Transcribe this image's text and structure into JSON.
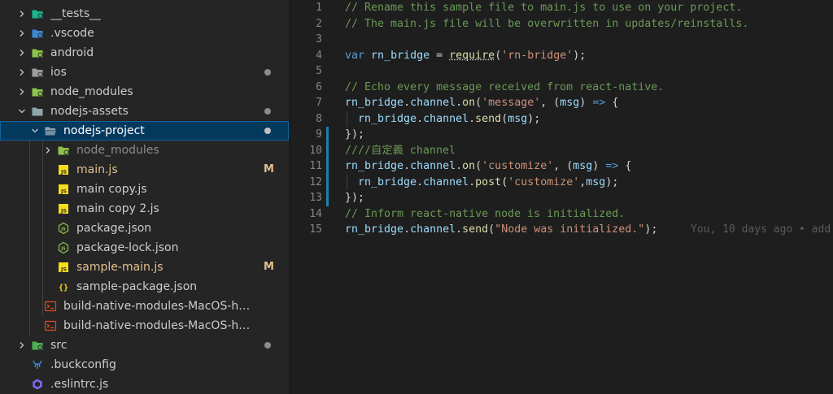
{
  "explorer": {
    "items": [
      {
        "label": "__tests__",
        "type": "folder",
        "icon": "test-folder-icon",
        "color": "#19b68f"
      },
      {
        "label": ".vscode",
        "type": "folder",
        "icon": "vscode-folder-icon",
        "color": "#3b88d6"
      },
      {
        "label": "android",
        "type": "folder",
        "icon": "android-folder-icon",
        "color": "#8bc34a"
      },
      {
        "label": "ios",
        "type": "folder",
        "icon": "ios-folder-icon",
        "color": "#9e9e9e",
        "status": "dot"
      },
      {
        "label": "node_modules",
        "type": "folder",
        "icon": "node-folder-icon",
        "color": "#8bc34a"
      },
      {
        "label": "nodejs-assets",
        "type": "folder",
        "icon": "folder-icon",
        "color": "#90a4ae",
        "status": "dot"
      },
      {
        "label": "nodejs-project",
        "type": "folder-open",
        "icon": "folder-open-icon",
        "color": "#90a4ae",
        "status": "dot",
        "selected": true
      },
      {
        "label": "node_modules",
        "type": "folder",
        "icon": "node-folder-icon",
        "color": "#8bc34a",
        "dimmed": true
      },
      {
        "label": "main.js",
        "type": "file",
        "icon": "js-file-icon",
        "color": "#f5de19",
        "badge": "M"
      },
      {
        "label": "main copy.js",
        "type": "file",
        "icon": "js-file-icon",
        "color": "#f5de19"
      },
      {
        "label": "main copy 2.js",
        "type": "file",
        "icon": "js-file-icon",
        "color": "#f5de19"
      },
      {
        "label": "package.json",
        "type": "file",
        "icon": "nodejs-file-icon",
        "color": "#8bc34a"
      },
      {
        "label": "package-lock.json",
        "type": "file",
        "icon": "nodejs-file-icon",
        "color": "#8bc34a"
      },
      {
        "label": "sample-main.js",
        "type": "file",
        "icon": "js-file-icon",
        "color": "#f5de19",
        "badge": "M"
      },
      {
        "label": "sample-package.json",
        "type": "file",
        "icon": "json-file-icon",
        "color": "#f5de19"
      },
      {
        "label": "build-native-modules-MacOS-helper-scrip...",
        "type": "file",
        "icon": "shell-file-icon",
        "color": "#e64a19"
      },
      {
        "label": "build-native-modules-MacOS-helper-scrip...",
        "type": "file",
        "icon": "shell-file-icon",
        "color": "#e64a19"
      },
      {
        "label": "src",
        "type": "folder",
        "icon": "src-folder-icon",
        "color": "#4caf50",
        "status": "dot"
      },
      {
        "label": ".buckconfig",
        "type": "file",
        "icon": "buck-file-icon",
        "color": "#3b88d6"
      },
      {
        "label": ".eslintrc.js",
        "type": "file",
        "icon": "eslint-file-icon",
        "color": "#7b68ee"
      }
    ]
  },
  "editor": {
    "lines": [
      {
        "num": "1",
        "tokens": [
          {
            "t": "// Rename this sample file to main.js to use on your project.",
            "c": "comment"
          }
        ]
      },
      {
        "num": "2",
        "tokens": [
          {
            "t": "// The main.js file will be overwritten in updates/reinstalls.",
            "c": "comment"
          }
        ]
      },
      {
        "num": "3",
        "tokens": []
      },
      {
        "num": "4",
        "tokens": [
          {
            "t": "var",
            "c": "keyword"
          },
          {
            "t": " ",
            "c": "plain"
          },
          {
            "t": "rn_bridge",
            "c": "var"
          },
          {
            "t": " = ",
            "c": "plain"
          },
          {
            "t": "require",
            "c": "req"
          },
          {
            "t": "(",
            "c": "plain"
          },
          {
            "t": "'rn-bridge'",
            "c": "string"
          },
          {
            "t": ");",
            "c": "plain"
          }
        ]
      },
      {
        "num": "5",
        "tokens": []
      },
      {
        "num": "6",
        "tokens": [
          {
            "t": "// Echo every message received from react-native.",
            "c": "comment"
          }
        ]
      },
      {
        "num": "7",
        "tokens": [
          {
            "t": "rn_bridge",
            "c": "var"
          },
          {
            "t": ".",
            "c": "plain"
          },
          {
            "t": "channel",
            "c": "var"
          },
          {
            "t": ".",
            "c": "plain"
          },
          {
            "t": "on",
            "c": "func"
          },
          {
            "t": "(",
            "c": "plain"
          },
          {
            "t": "'message'",
            "c": "string"
          },
          {
            "t": ", (",
            "c": "plain"
          },
          {
            "t": "msg",
            "c": "var"
          },
          {
            "t": ") ",
            "c": "plain"
          },
          {
            "t": "=>",
            "c": "keyword"
          },
          {
            "t": " {",
            "c": "plain"
          }
        ]
      },
      {
        "num": "8",
        "tokens": [
          {
            "t": "  ",
            "c": "plain"
          },
          {
            "t": "rn_bridge",
            "c": "var"
          },
          {
            "t": ".",
            "c": "plain"
          },
          {
            "t": "channel",
            "c": "var"
          },
          {
            "t": ".",
            "c": "plain"
          },
          {
            "t": "send",
            "c": "func"
          },
          {
            "t": "(",
            "c": "plain"
          },
          {
            "t": "msg",
            "c": "var"
          },
          {
            "t": ");",
            "c": "plain"
          }
        ]
      },
      {
        "num": "9",
        "tokens": [
          {
            "t": "});",
            "c": "plain"
          }
        ]
      },
      {
        "num": "10",
        "tokens": [
          {
            "t": "////自定義 channel",
            "c": "comment"
          }
        ]
      },
      {
        "num": "11",
        "tokens": [
          {
            "t": "rn_bridge",
            "c": "var"
          },
          {
            "t": ".",
            "c": "plain"
          },
          {
            "t": "channel",
            "c": "var"
          },
          {
            "t": ".",
            "c": "plain"
          },
          {
            "t": "on",
            "c": "func"
          },
          {
            "t": "(",
            "c": "plain"
          },
          {
            "t": "'customize'",
            "c": "string"
          },
          {
            "t": ", (",
            "c": "plain"
          },
          {
            "t": "msg",
            "c": "var"
          },
          {
            "t": ") ",
            "c": "plain"
          },
          {
            "t": "=>",
            "c": "keyword"
          },
          {
            "t": " {",
            "c": "plain"
          }
        ]
      },
      {
        "num": "12",
        "tokens": [
          {
            "t": "  ",
            "c": "plain"
          },
          {
            "t": "rn_bridge",
            "c": "var"
          },
          {
            "t": ".",
            "c": "plain"
          },
          {
            "t": "channel",
            "c": "var"
          },
          {
            "t": ".",
            "c": "plain"
          },
          {
            "t": "post",
            "c": "func"
          },
          {
            "t": "(",
            "c": "plain"
          },
          {
            "t": "'customize'",
            "c": "string"
          },
          {
            "t": ",",
            "c": "plain"
          },
          {
            "t": "msg",
            "c": "var"
          },
          {
            "t": ");",
            "c": "plain"
          }
        ]
      },
      {
        "num": "13",
        "tokens": [
          {
            "t": "});",
            "c": "plain"
          }
        ]
      },
      {
        "num": "14",
        "tokens": [
          {
            "t": "// Inform react-native node is initialized.",
            "c": "comment"
          }
        ]
      },
      {
        "num": "15",
        "tokens": [
          {
            "t": "rn_bridge",
            "c": "var"
          },
          {
            "t": ".",
            "c": "plain"
          },
          {
            "t": "channel",
            "c": "var"
          },
          {
            "t": ".",
            "c": "plain"
          },
          {
            "t": "send",
            "c": "func"
          },
          {
            "t": "(",
            "c": "plain"
          },
          {
            "t": "\"Node was initialized.\"",
            "c": "string"
          },
          {
            "t": ");",
            "c": "plain"
          }
        ]
      }
    ],
    "blame": "You, 10 days ago • add"
  }
}
